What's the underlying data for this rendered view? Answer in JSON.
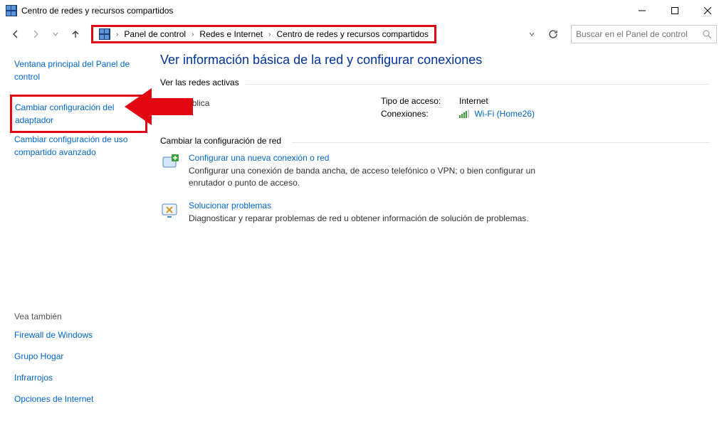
{
  "window": {
    "title": "Centro de redes y recursos compartidos"
  },
  "breadcrumb": {
    "items": [
      "Panel de control",
      "Redes e Internet",
      "Centro de redes y recursos compartidos"
    ]
  },
  "search": {
    "placeholder": "Buscar en el Panel de control"
  },
  "sidebar": {
    "links": [
      "Ventana principal del Panel de control",
      "Cambiar configuración del adaptador",
      "Cambiar configuración de uso compartido avanzado"
    ],
    "see_also_header": "Vea también",
    "see_also": [
      "Firewall de Windows",
      "Grupo Hogar",
      "Infrarrojos",
      "Opciones de Internet"
    ]
  },
  "main": {
    "title": "Ver información básica de la red y configurar conexiones",
    "active_header": "Ver las redes activas",
    "network": {
      "name": "",
      "type": "Red pública",
      "access_label": "Tipo de acceso:",
      "access_value": "Internet",
      "conn_label": "Conexiones:",
      "conn_value": "Wi-Fi (Home26)"
    },
    "change_header": "Cambiar la configuración de red",
    "items": [
      {
        "title": "Configurar una nueva conexión o red",
        "desc": "Configurar una conexión de banda ancha, de acceso telefónico o VPN; o bien configurar un enrutador o punto de acceso."
      },
      {
        "title": "Solucionar problemas",
        "desc": "Diagnosticar y reparar problemas de red u obtener información de solución de problemas."
      }
    ]
  }
}
